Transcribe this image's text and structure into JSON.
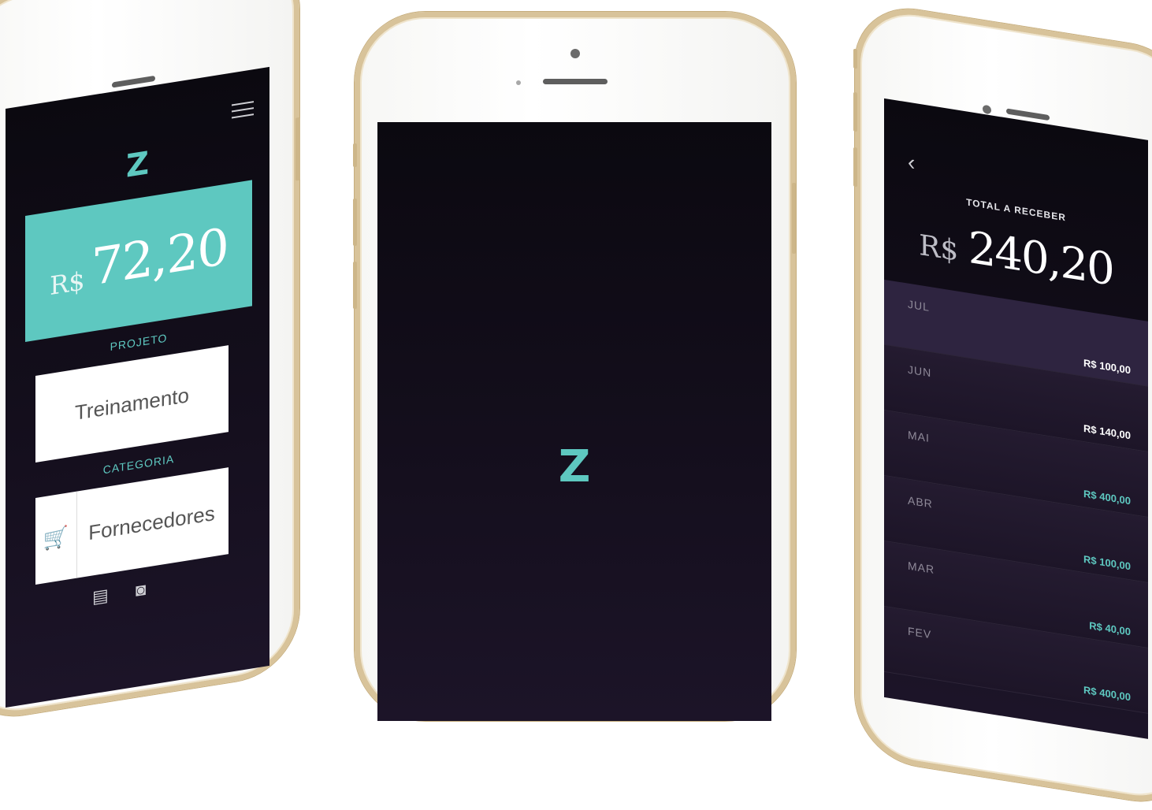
{
  "brand": {
    "logo": "Z",
    "accent": "#5ec8c0"
  },
  "left_screen": {
    "currency": "R$",
    "amount": "72,20",
    "project_label": "PROJETO",
    "project_value": "Treinamento",
    "category_label": "CATEGORIA",
    "category_value": "Fornecedores",
    "icons": [
      "menu-icon",
      "cart-icon",
      "comment-icon",
      "camera-icon"
    ]
  },
  "center_screen": {
    "logo": "Z"
  },
  "right_screen": {
    "total_label": "TOTAL A RECEBER",
    "currency": "R$",
    "total_amount": "240,20",
    "months": [
      {
        "name": "JUL",
        "value": "R$ 100,00",
        "color": "#ffffff"
      },
      {
        "name": "JUN",
        "value": "R$ 140,00",
        "color": "#ffffff"
      },
      {
        "name": "MAI",
        "value": "R$ 400,00",
        "color": "#5ec8c0"
      },
      {
        "name": "ABR",
        "value": "R$ 100,00",
        "color": "#5ec8c0"
      },
      {
        "name": "MAR",
        "value": "R$ 40,00",
        "color": "#5ec8c0"
      },
      {
        "name": "FEV",
        "value": "R$ 400,00",
        "color": "#5ec8c0"
      }
    ]
  }
}
